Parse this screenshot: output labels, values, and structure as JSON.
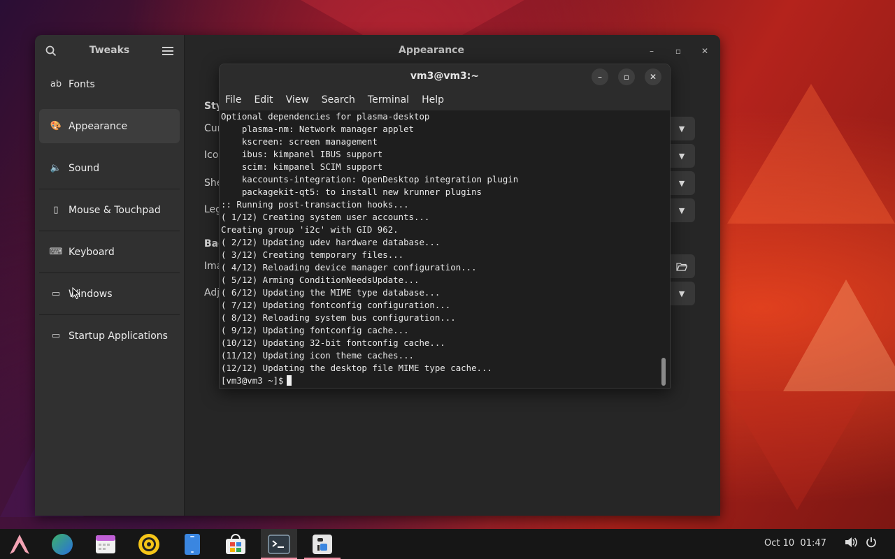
{
  "tweaks": {
    "title": "Tweaks",
    "page_title": "Appearance",
    "sidebar": [
      {
        "label": "Fonts",
        "icon": "fonts-icon",
        "glyph": "ab"
      },
      {
        "label": "Appearance",
        "icon": "appearance-icon",
        "glyph": "🎨"
      },
      {
        "label": "Sound",
        "icon": "speaker-icon",
        "glyph": "🔈"
      },
      {
        "label": "Mouse & Touchpad",
        "icon": "mouse-icon",
        "glyph": "▯"
      },
      {
        "label": "Keyboard",
        "icon": "keyboard-icon",
        "glyph": "⌨"
      },
      {
        "label": "Windows",
        "icon": "window-icon",
        "glyph": "▭"
      },
      {
        "label": "Startup Applications",
        "icon": "folder-icon",
        "glyph": "▭"
      }
    ],
    "selected_index": 1,
    "main_labels": {
      "styles_heading": "Sty",
      "cursor": "Cur",
      "icons": "Icon",
      "shell": "She",
      "legacy": "Leg",
      "background_heading": "Bac",
      "image": "Ima",
      "adjustment": "Adj"
    }
  },
  "terminal": {
    "title": "vm3@vm3:~",
    "menu": [
      "File",
      "Edit",
      "View",
      "Search",
      "Terminal",
      "Help"
    ],
    "lines": [
      "Optional dependencies for plasma-desktop",
      "    plasma-nm: Network manager applet",
      "    kscreen: screen management",
      "    ibus: kimpanel IBUS support",
      "    scim: kimpanel SCIM support",
      "    kaccounts-integration: OpenDesktop integration plugin",
      "    packagekit-qt5: to install new krunner plugins",
      ":: Running post-transaction hooks...",
      "( 1/12) Creating system user accounts...",
      "Creating group 'i2c' with GID 962.",
      "( 2/12) Updating udev hardware database...",
      "( 3/12) Creating temporary files...",
      "( 4/12) Reloading device manager configuration...",
      "( 5/12) Arming ConditionNeedsUpdate...",
      "( 6/12) Updating the MIME type database...",
      "( 7/12) Updating fontconfig configuration...",
      "( 8/12) Reloading system bus configuration...",
      "( 9/12) Updating fontconfig cache...",
      "(10/12) Updating 32-bit fontconfig cache...",
      "(11/12) Updating icon theme caches...",
      "(12/12) Updating the desktop file MIME type cache..."
    ],
    "prompt": "[vm3@vm3 ~]$"
  },
  "taskbar": {
    "apps": [
      {
        "name": "arch-logo-icon"
      },
      {
        "name": "web-browser-icon"
      },
      {
        "name": "calendar-icon"
      },
      {
        "name": "music-player-icon"
      },
      {
        "name": "phone-icon"
      },
      {
        "name": "software-store-icon"
      },
      {
        "name": "terminal-icon"
      },
      {
        "name": "tweaks-icon"
      }
    ],
    "date": "Oct 10",
    "time": "01:47"
  },
  "colors": {
    "accent_active": "#f08da3"
  }
}
